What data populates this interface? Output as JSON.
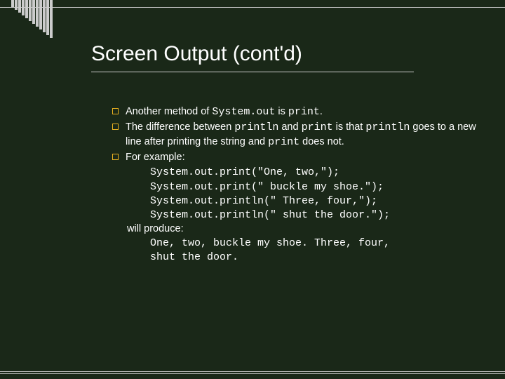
{
  "title": "Screen Output (cont'd)",
  "bullets": {
    "b1a": "Another method of ",
    "b1b": "System.out",
    "b1c": " is ",
    "b1d": "print",
    "b1e": ".",
    "b2a": "The difference between ",
    "b2b": "println",
    "b2c": " and ",
    "b2d": "print",
    "b2e": " is that ",
    "b2f": "println",
    "b2g": " goes to a new line after printing the string and ",
    "b2h": "print",
    "b2i": " does not.",
    "b3a": "For example:"
  },
  "code": {
    "l1": "System.out.print(\"One, two,\");",
    "l2": "System.out.print(\" buckle my shoe.\");",
    "l3": "System.out.println(\" Three, four,\");",
    "l4": "System.out.println(\" shut the door.\");"
  },
  "produce": "will produce:",
  "output": {
    "l1": "One, two, buckle my shoe. Three, four,",
    "l2": " shut the door."
  }
}
